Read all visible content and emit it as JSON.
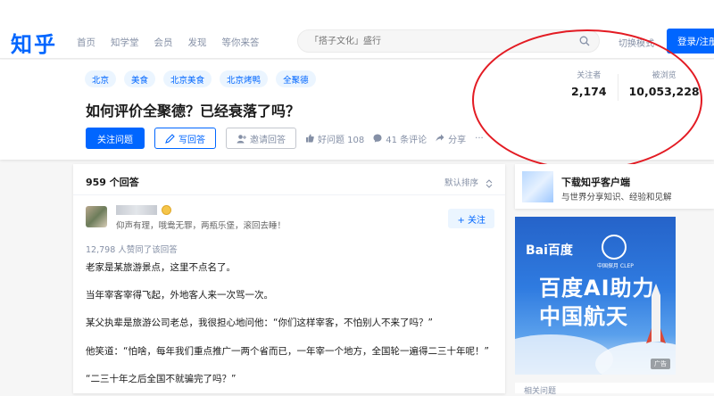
{
  "header": {
    "logo": "知乎",
    "nav": [
      "首页",
      "知学堂",
      "会员",
      "发现",
      "等你来答"
    ],
    "search_placeholder": "「搭子文化」盛行",
    "switch_mode": "切换模式",
    "login": "登录/注册"
  },
  "question": {
    "topics": [
      "北京",
      "美食",
      "北京美食",
      "北京烤鸭",
      "全聚德"
    ],
    "title": "如何评价全聚德？已经衰落了吗？",
    "follow_btn": "关注问题",
    "write_btn": "写回答",
    "invite_btn": "邀请回答",
    "good_q": "好问题 108",
    "comments": "41 条评论",
    "share": "分享",
    "more": "···",
    "stats": {
      "followers_label": "关注者",
      "followers": "2,174",
      "views_label": "被浏览",
      "views": "10,053,228"
    }
  },
  "answers": {
    "count": "959 个回答",
    "sort": "默认排序",
    "author_bio": "仰声有理，哦鸯无罪，两瓶乐堡，滚回去睡！",
    "follow": "+ 关注",
    "votes": "12,798 人赞同了该回答",
    "paragraphs": [
      "老家是某旅游景点，这里不点名了。",
      "当年宰客宰得飞起，外地客人来一次骂一次。",
      "某父执辈是旅游公司老总，我很担心地问他：“你们这样宰客，不怕别人不来了吗？”",
      "他笑道：“怕啥，每年我们重点推广一两个省而已，一年宰一个地方，全国轮一遍得二三十年呢！”",
      "“二三十年之后全国不就骗完了吗？”"
    ]
  },
  "sidebar": {
    "app_title": "下载知乎客户端",
    "app_sub": "与世界分享知识、经验和见解",
    "ad": {
      "brand": "Bai百度",
      "clep": "中国探月 CLEP",
      "line1": "百度AI助力",
      "line2": "中国航天",
      "label": "广告"
    },
    "related": "相关问题"
  }
}
